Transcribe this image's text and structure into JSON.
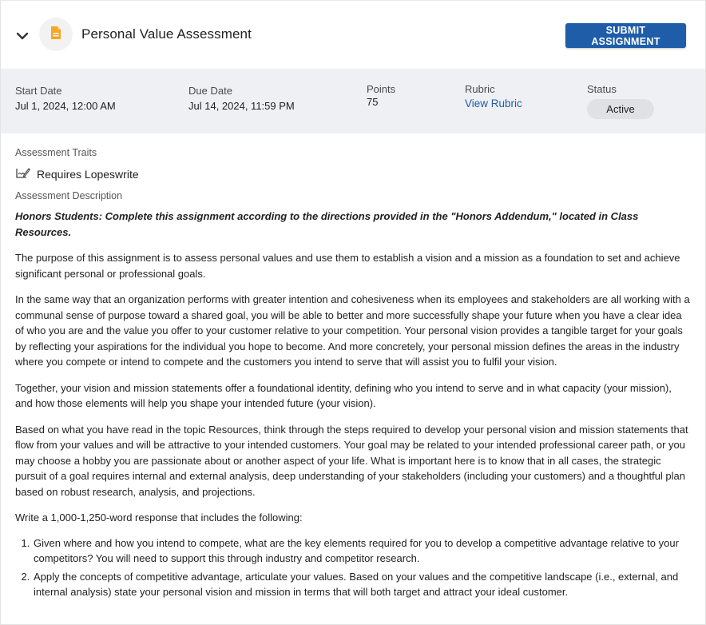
{
  "header": {
    "title": "Personal Value Assessment",
    "submit_label": "SUBMIT ASSIGNMENT"
  },
  "meta": {
    "start": {
      "label": "Start Date",
      "value": "Jul 1, 2024, 12:00 AM"
    },
    "due": {
      "label": "Due Date",
      "value": "Jul 14, 2024, 11:59 PM"
    },
    "points": {
      "label": "Points",
      "value": "75"
    },
    "rubric": {
      "label": "Rubric",
      "link": "View Rubric"
    },
    "status": {
      "label": "Status",
      "value": "Active"
    }
  },
  "traits": {
    "label": "Assessment Traits",
    "items": [
      "Requires Lopeswrite"
    ]
  },
  "description": {
    "label": "Assessment Description",
    "honors": "Honors Students: Complete this assignment according to the directions provided in the \"Honors Addendum,\" located in Class Resources.",
    "paragraphs": [
      "The purpose of this assignment is to assess personal values and use them to establish a vision and a mission as a foundation to set and achieve significant personal or professional goals.",
      "In the same way that an organization performs with greater intention and cohesiveness when its employees and stakeholders are all working with a communal sense of purpose toward a shared goal, you will be able to better and more successfully shape your future when you have a clear idea of who you are and the value you offer to your customer relative to your competition. Your personal vision provides a tangible target for your goals by reflecting your aspirations for the individual you hope to become. And more concretely, your personal mission defines the areas in the industry where you compete or intend to compete and the customers you intend to serve that will assist you to fulfil your vision.",
      "Together, your vision and mission statements offer a foundational identity, defining who you intend to serve and in what capacity (your mission), and how those elements will help you shape your intended future (your vision).",
      "Based on what you have read in the topic Resources, think through the steps required to develop your personal vision and mission statements that flow from your values and will be attractive to your intended customers. Your goal may be related to your intended professional career path, or you may choose a hobby you are passionate about or another aspect of your life. What is important here is to know that in all cases, the strategic pursuit of a goal requires internal and external analysis, deep understanding of your stakeholders (including your customers) and a thoughtful plan based on robust research, analysis, and projections.",
      "Write a 1,000-1,250-word response that includes the following:"
    ],
    "list": [
      "Given where and how you intend to compete, what are the key elements required for you to develop a competitive advantage relative to your competitors? You will need to support this through industry and competitor research.",
      "Apply the concepts of competitive advantage, articulate your values. Based on your values and the competitive landscape (i.e., external, and internal analysis) state your personal vision and mission in terms that will both target and attract your ideal customer."
    ]
  },
  "colors": {
    "accent": "#1f5da9",
    "meta_band": "#eef0f4",
    "doc_icon": "#f5a623"
  },
  "icons": {
    "collapse": "chevron-down-icon",
    "document": "document-icon",
    "trait": "signature-icon"
  }
}
